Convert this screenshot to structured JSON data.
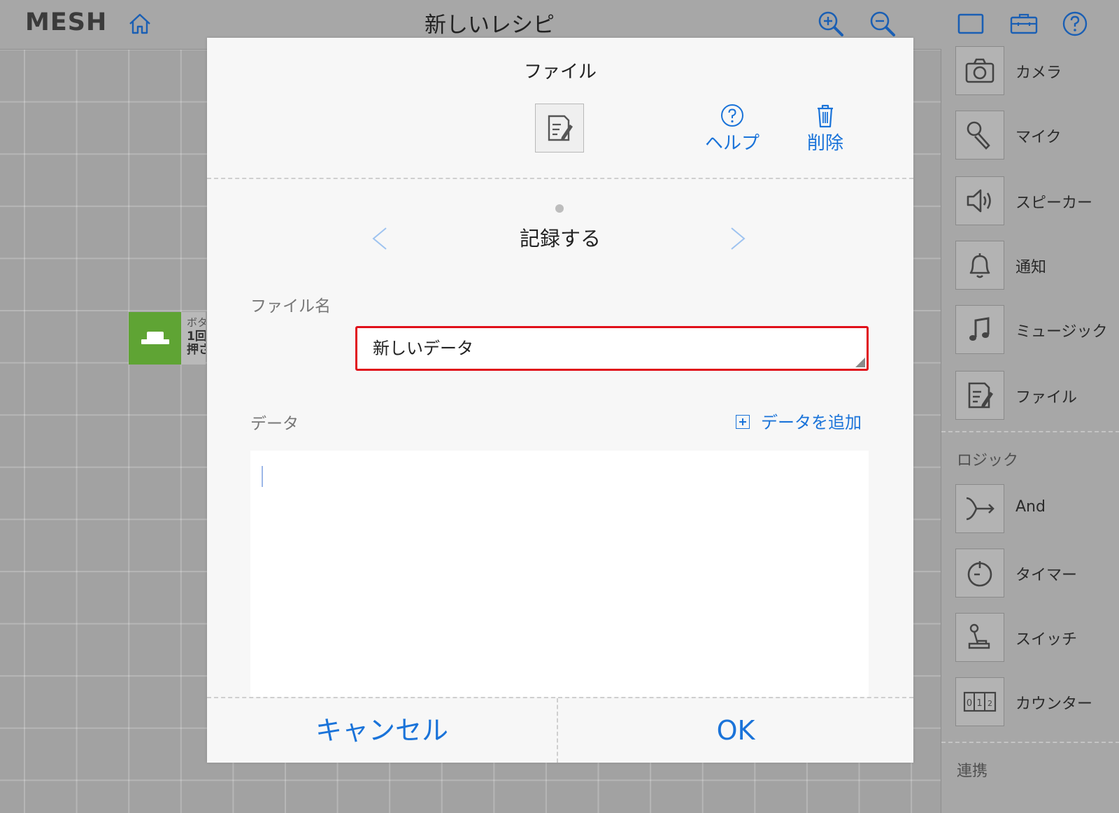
{
  "app": {
    "logo": "MESH",
    "recipe_title": "新しいレシピ"
  },
  "toolbar": {
    "icons": [
      "home-icon",
      "zoom-in-icon",
      "zoom-out-icon",
      "window-icon",
      "toolbox-icon",
      "help-icon"
    ]
  },
  "canvas_node": {
    "name": "ボタン",
    "event_line1": "1回",
    "event_line2": "押され",
    "color": "#5fa434"
  },
  "palette": {
    "items": [
      {
        "label": "カメラ",
        "icon": "camera-icon"
      },
      {
        "label": "マイク",
        "icon": "microphone-icon"
      },
      {
        "label": "スピーカー",
        "icon": "speaker-icon"
      },
      {
        "label": "通知",
        "icon": "bell-icon"
      },
      {
        "label": "ミュージック",
        "icon": "music-note-icon"
      },
      {
        "label": "ファイル",
        "icon": "file-edit-icon"
      }
    ],
    "logic_section": "ロジック",
    "logic_items": [
      {
        "label": "And",
        "icon": "and-merge-icon"
      },
      {
        "label": "タイマー",
        "icon": "timer-icon"
      },
      {
        "label": "スイッチ",
        "icon": "switch-icon"
      },
      {
        "label": "カウンター",
        "icon": "counter-icon"
      }
    ],
    "link_section": "連携"
  },
  "modal": {
    "title": "ファイル",
    "help_label": "ヘルプ",
    "delete_label": "削除",
    "action_title": "記録する",
    "filename_label": "ファイル名",
    "filename_value": "新しいデータ",
    "data_label": "データ",
    "add_data_label": "データを追加",
    "data_value": "",
    "cancel_label": "キャンセル",
    "ok_label": "OK",
    "accent_color": "#1a73d9",
    "highlight_color": "#e0101a"
  }
}
